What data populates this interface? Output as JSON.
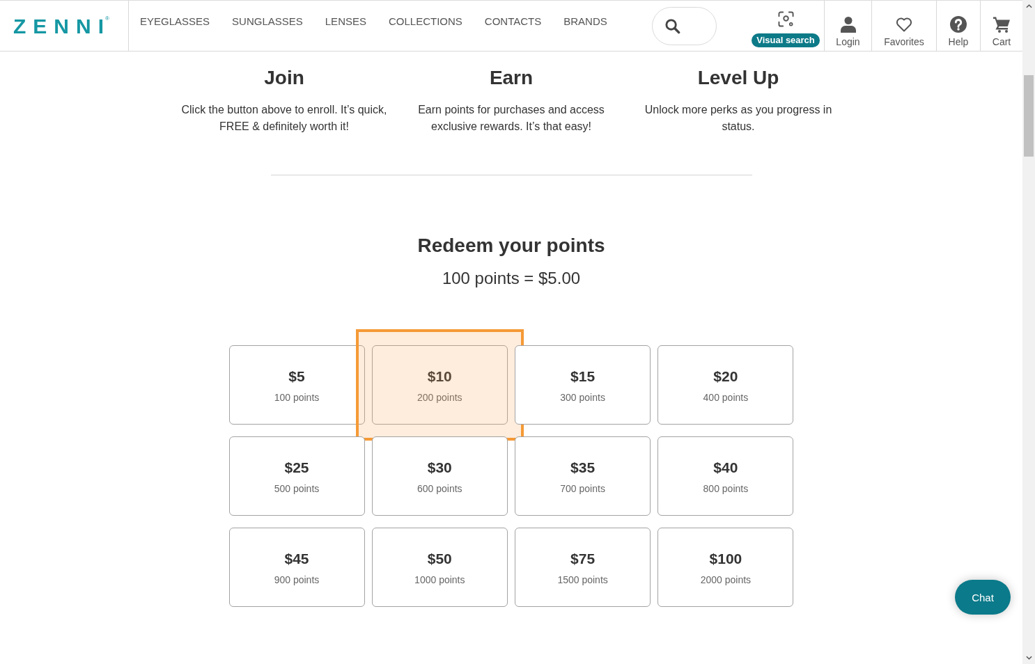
{
  "header": {
    "logo": {
      "text": "ZENNI",
      "mark": "®"
    },
    "nav": [
      {
        "label": "EYEGLASSES"
      },
      {
        "label": "SUNGLASSES"
      },
      {
        "label": "LENSES"
      },
      {
        "label": "COLLECTIONS"
      },
      {
        "label": "CONTACTS"
      },
      {
        "label": "BRANDS"
      }
    ],
    "visual_search": {
      "label": "Visual search"
    },
    "actions": [
      {
        "kind": "login",
        "label": "Login"
      },
      {
        "kind": "favorites",
        "label": "Favorites"
      },
      {
        "kind": "help",
        "label": "Help"
      },
      {
        "kind": "cart",
        "label": "Cart"
      }
    ]
  },
  "steps": [
    {
      "title": "Join",
      "text": "Click the button above to enroll. It’s quick, FREE & definitely worth it!"
    },
    {
      "title": "Earn",
      "text": "Earn points for purchases and access exclusive rewards. It’s that easy!"
    },
    {
      "title": "Level Up",
      "text": "Unlock more perks as you progress in status."
    }
  ],
  "redeem": {
    "title": "Redeem your points",
    "rate": "100 points = $5.00",
    "rewards": [
      {
        "amount": "$5",
        "points": "100 points",
        "highlighted": false
      },
      {
        "amount": "$10",
        "points": "200 points",
        "highlighted": true
      },
      {
        "amount": "$15",
        "points": "300 points",
        "highlighted": false
      },
      {
        "amount": "$20",
        "points": "400 points",
        "highlighted": false
      },
      {
        "amount": "$25",
        "points": "500 points",
        "highlighted": false
      },
      {
        "amount": "$30",
        "points": "600 points",
        "highlighted": false
      },
      {
        "amount": "$35",
        "points": "700 points",
        "highlighted": false
      },
      {
        "amount": "$40",
        "points": "800 points",
        "highlighted": false
      },
      {
        "amount": "$45",
        "points": "900 points",
        "highlighted": false
      },
      {
        "amount": "$50",
        "points": "1000 points",
        "highlighted": false
      },
      {
        "amount": "$75",
        "points": "1500 points",
        "highlighted": false
      },
      {
        "amount": "$100",
        "points": "2000 points",
        "highlighted": false
      }
    ]
  },
  "chat": {
    "label": "Chat"
  }
}
